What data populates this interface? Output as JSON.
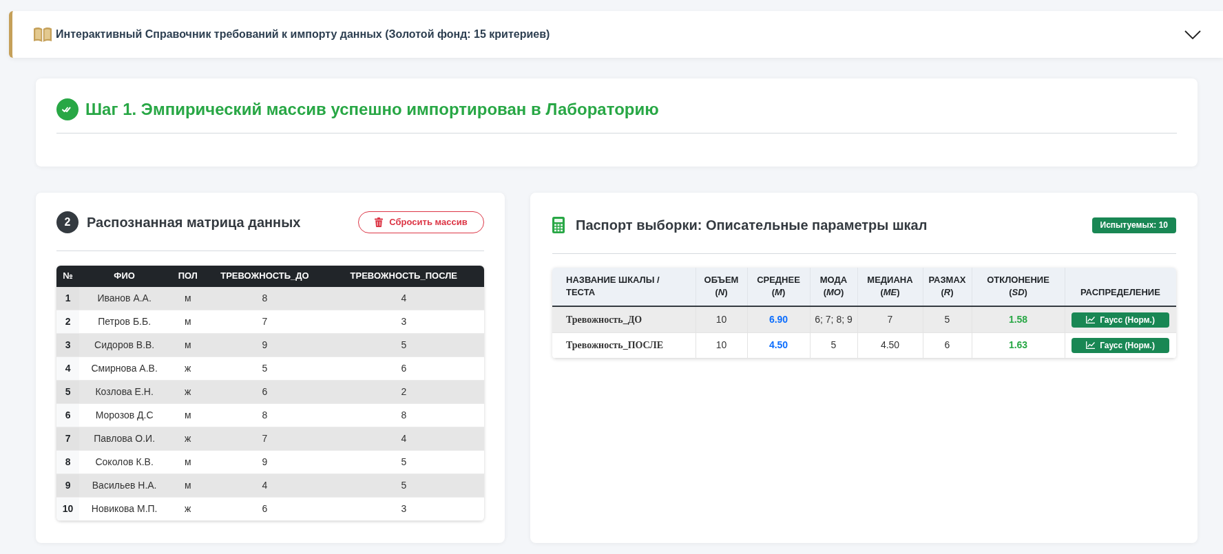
{
  "reference_panel": {
    "title": "Интерактивный Справочник требований к импорту данных (Золотой фонд: 15 критериев)",
    "expanded": false
  },
  "step_one": {
    "title": "Шаг 1. Эмпирический массив успешно импортирован в Лабораторию"
  },
  "data_matrix": {
    "step_number": "2",
    "title": "Распознанная матрица данных",
    "reset_button": "Сбросить массив",
    "table": {
      "columns": [
        "№",
        "ФИО",
        "ПОЛ",
        "ТРЕВОЖНОСТЬ_ДО",
        "ТРЕВОЖНОСТЬ_ПОСЛЕ"
      ],
      "rows": [
        [
          "1",
          "Иванов А.А.",
          "м",
          "8",
          "4"
        ],
        [
          "2",
          "Петров Б.Б.",
          "м",
          "7",
          "3"
        ],
        [
          "3",
          "Сидоров В.В.",
          "м",
          "9",
          "5"
        ],
        [
          "4",
          "Смирнова А.В.",
          "ж",
          "5",
          "6"
        ],
        [
          "5",
          "Козлова Е.Н.",
          "ж",
          "6",
          "2"
        ],
        [
          "6",
          "Морозов Д.С",
          "м",
          "8",
          "8"
        ],
        [
          "7",
          "Павлова О.И.",
          "ж",
          "7",
          "4"
        ],
        [
          "8",
          "Соколов К.В.",
          "м",
          "9",
          "5"
        ],
        [
          "9",
          "Васильев Н.А.",
          "м",
          "4",
          "5"
        ],
        [
          "10",
          "Новикова М.П.",
          "ж",
          "6",
          "3"
        ]
      ]
    }
  },
  "sample_passport": {
    "title": "Паспорт выборки: Описательные параметры шкал",
    "subjects_badge": "Испытуемых: 10",
    "table": {
      "columns": [
        "НАЗВАНИЕ ШКАЛЫ / ТЕСТА",
        "ОБЪЕМ (*N*)",
        "СРЕДНЕЕ (*M*)",
        "МОДА (*MO*)",
        "МЕДИАНА (*ME*)",
        "РАЗМАХ (*R*)",
        "ОТКЛОНЕНИЕ (*SD*)",
        "РАСПРЕДЕЛЕНИЕ"
      ],
      "rows": [
        {
          "scale": "Тревожность_ДО",
          "n": "10",
          "mean": "6.90",
          "mode": "6; 7; 8; 9",
          "median": "7",
          "range": "5",
          "sd": "1.58",
          "distribution": "Гаусс (Норм.)"
        },
        {
          "scale": "Тревожность_ПОСЛЕ",
          "n": "10",
          "mean": "4.50",
          "mode": "5",
          "median": "4.50",
          "range": "6",
          "sd": "1.63",
          "distribution": "Гаусс (Норм.)"
        }
      ]
    }
  }
}
